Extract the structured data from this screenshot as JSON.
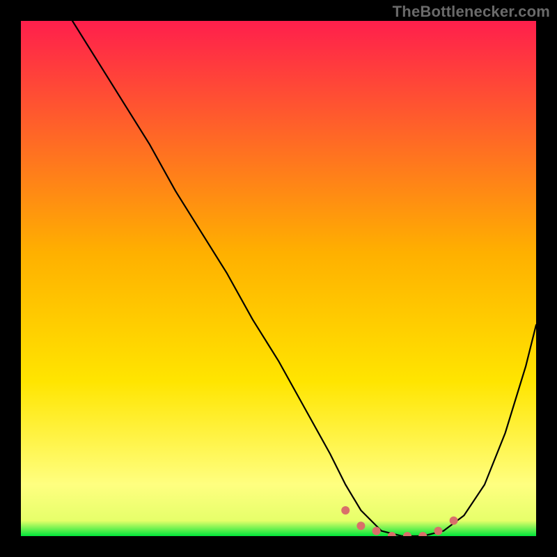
{
  "watermark": "TheBottlenecker.com",
  "colors": {
    "bg": "#000000",
    "grad_top": "#ff1f4c",
    "grad_mid": "#ffd400",
    "grad_low": "#ffff66",
    "grad_bottom": "#00e63a",
    "curve": "#000000",
    "marker": "#d96f6a"
  },
  "chart_data": {
    "type": "line",
    "title": "",
    "xlabel": "",
    "ylabel": "",
    "xlim": [
      0,
      100
    ],
    "ylim": [
      0,
      100
    ],
    "series": [
      {
        "name": "bottleneck-curve",
        "x": [
          10,
          15,
          20,
          25,
          30,
          35,
          40,
          45,
          50,
          55,
          60,
          63,
          66,
          70,
          74,
          78,
          82,
          86,
          90,
          94,
          98,
          100
        ],
        "values": [
          100,
          92,
          84,
          76,
          67,
          59,
          51,
          42,
          34,
          25,
          16,
          10,
          5,
          1,
          0,
          0,
          1,
          4,
          10,
          20,
          33,
          41
        ]
      }
    ],
    "markers": {
      "name": "optimal-band",
      "x": [
        63,
        66,
        69,
        72,
        75,
        78,
        81,
        84
      ],
      "values": [
        5,
        2,
        1,
        0,
        0,
        0,
        1,
        3
      ]
    },
    "gradient_stops": [
      {
        "offset": 0.0,
        "color": "#ff1f4c"
      },
      {
        "offset": 0.45,
        "color": "#ffb000"
      },
      {
        "offset": 0.7,
        "color": "#ffe500"
      },
      {
        "offset": 0.9,
        "color": "#ffff80"
      },
      {
        "offset": 0.97,
        "color": "#e6ff6a"
      },
      {
        "offset": 1.0,
        "color": "#00e63a"
      }
    ]
  }
}
